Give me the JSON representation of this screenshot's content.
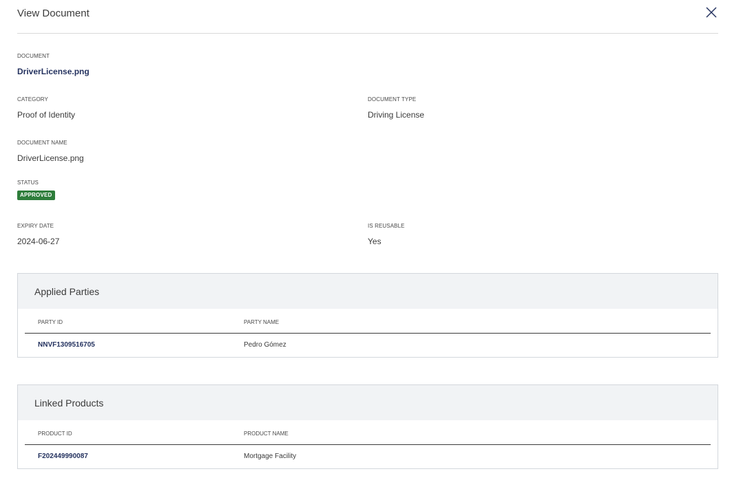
{
  "header": {
    "title": "View Document"
  },
  "fields": {
    "document": {
      "label": "DOCUMENT",
      "value": "DriverLicense.png"
    },
    "category": {
      "label": "CATEGORY",
      "value": "Proof of Identity"
    },
    "document_type": {
      "label": "DOCUMENT TYPE",
      "value": "Driving License"
    },
    "document_name": {
      "label": "DOCUMENT NAME",
      "value": "DriverLicense.png"
    },
    "status": {
      "label": "STATUS",
      "value": "APPROVED",
      "color": "#2e7d3b"
    },
    "expiry_date": {
      "label": "EXPIRY DATE",
      "value": "2024-06-27"
    },
    "is_reusable": {
      "label": "IS REUSABLE",
      "value": "Yes"
    }
  },
  "applied_parties": {
    "title": "Applied Parties",
    "columns": [
      "PARTY ID",
      "PARTY NAME"
    ],
    "rows": [
      {
        "party_id": "NNVF1309516705",
        "party_name": "Pedro Gómez"
      }
    ]
  },
  "linked_products": {
    "title": "Linked Products",
    "columns": [
      "PRODUCT ID",
      "PRODUCT NAME"
    ],
    "rows": [
      {
        "product_id": "F202449990087",
        "product_name": "Mortgage Facility"
      }
    ]
  },
  "icons": {
    "close": "close-icon"
  },
  "colors": {
    "link": "#24325f",
    "status_approved": "#2e7d3b",
    "panel_header_bg": "#f1f3f5"
  }
}
